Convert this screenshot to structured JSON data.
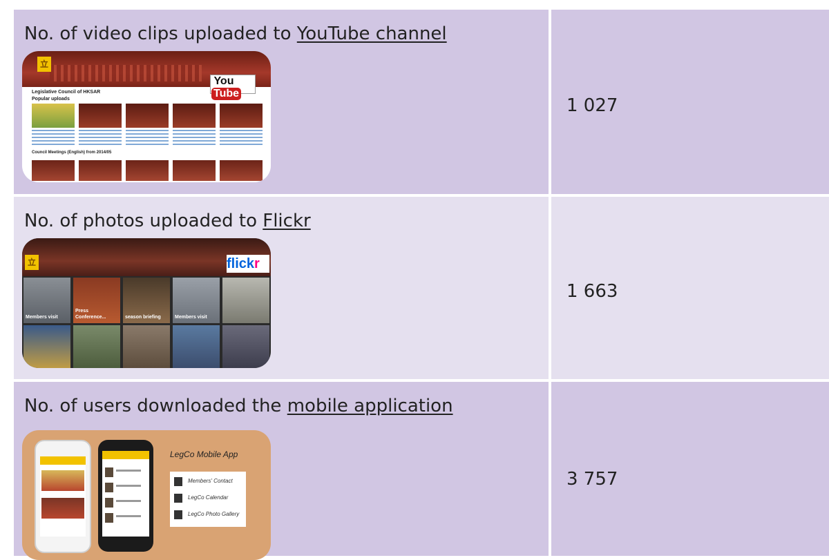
{
  "rows": [
    {
      "label_prefix": "No. of video clips uploaded to ",
      "label_link": "YouTube channel",
      "value": "1 027",
      "thumbnail": {
        "logo": "YouTube",
        "heading": "Legislative Council of HKSAR",
        "section1": "Popular uploads",
        "section2": "Council Meetings (English) from 2014/05"
      }
    },
    {
      "label_prefix": "No. of photos uploaded to ",
      "label_link": "Flickr",
      "value": "1 663",
      "thumbnail": {
        "logo_a": "flick",
        "logo_b": "r",
        "captions": [
          "Members visit",
          "Press Conference...",
          "season briefing",
          "Members visit",
          "",
          "",
          "",
          "",
          "",
          ""
        ]
      }
    },
    {
      "label_prefix": "No. of users downloaded the ",
      "label_link": "mobile application",
      "value": "3 757",
      "thumbnail": {
        "title": "LegCo Mobile App",
        "menu": [
          "Members' Contact",
          "LegCo Calendar",
          "LegCo Photo Gallery"
        ]
      }
    }
  ]
}
